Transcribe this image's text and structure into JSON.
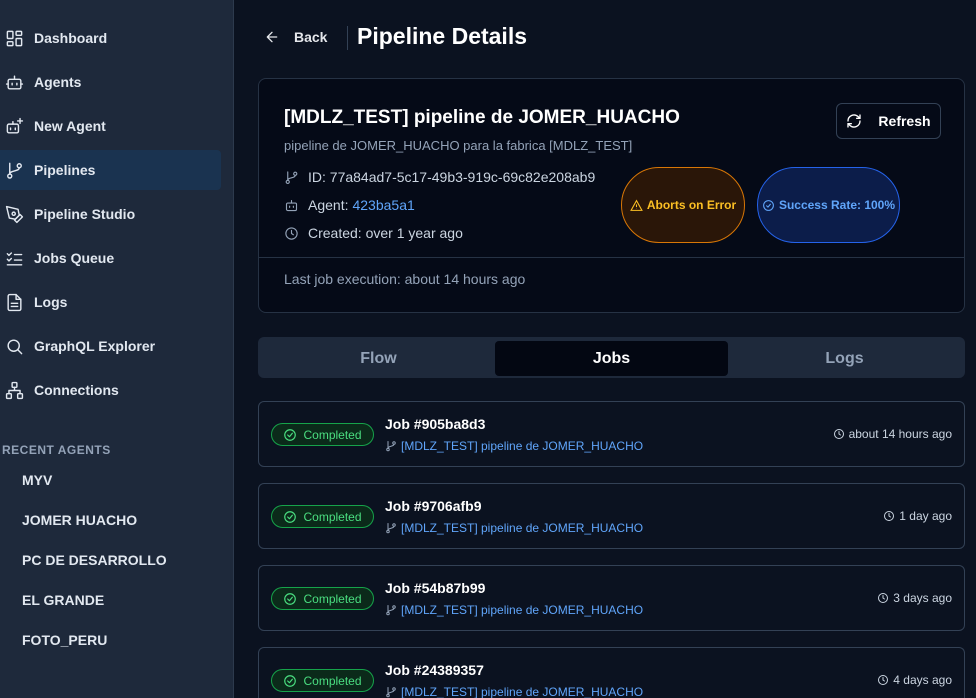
{
  "sidebar": {
    "items": [
      {
        "label": "Dashboard",
        "icon": "dashboard-icon"
      },
      {
        "label": "Agents",
        "icon": "bot-icon"
      },
      {
        "label": "New Agent",
        "icon": "bot-plus-icon"
      },
      {
        "label": "Pipelines",
        "icon": "git-branch-icon",
        "active": true
      },
      {
        "label": "Pipeline Studio",
        "icon": "pen-tool-icon"
      },
      {
        "label": "Jobs Queue",
        "icon": "list-checks-icon"
      },
      {
        "label": "Logs",
        "icon": "file-text-icon"
      },
      {
        "label": "GraphQL Explorer",
        "icon": "search-icon"
      },
      {
        "label": "Connections",
        "icon": "network-icon"
      }
    ],
    "recent_title": "RECENT AGENTS",
    "recent_agents": [
      "MYV",
      "JOMER HUACHO",
      "PC DE DESARROLLO",
      "EL GRANDE",
      "FOTO_PERU"
    ]
  },
  "header": {
    "back_label": "Back",
    "title": "Pipeline Details"
  },
  "pipeline": {
    "name": "[MDLZ_TEST] pipeline de JOMER_HUACHO",
    "description": "pipeline de JOMER_HUACHO para la fabrica [MDLZ_TEST]",
    "id_label": "ID: 77a84ad7-5c17-49b3-919c-69c82e208ab9",
    "agent_prefix": "Agent:",
    "agent_id": "423ba5a1",
    "created_label": "Created: over 1 year ago",
    "abort_badge": "Aborts on Error",
    "success_badge": "Success Rate: 100%",
    "refresh_label": "Refresh",
    "last_execution": "Last job execution: about 14 hours ago"
  },
  "tabs": [
    {
      "label": "Flow",
      "active": false
    },
    {
      "label": "Jobs",
      "active": true
    },
    {
      "label": "Logs",
      "active": false
    }
  ],
  "jobs": [
    {
      "status": "Completed",
      "title": "Job #905ba8d3",
      "pipeline": "[MDLZ_TEST] pipeline de JOMER_HUACHO",
      "time": "about 14 hours ago"
    },
    {
      "status": "Completed",
      "title": "Job #9706afb9",
      "pipeline": "[MDLZ_TEST] pipeline de JOMER_HUACHO",
      "time": "1 day ago"
    },
    {
      "status": "Completed",
      "title": "Job #54b87b99",
      "pipeline": "[MDLZ_TEST] pipeline de JOMER_HUACHO",
      "time": "3 days ago"
    },
    {
      "status": "Completed",
      "title": "Job #24389357",
      "pipeline": "[MDLZ_TEST] pipeline de JOMER_HUACHO",
      "time": "4 days ago"
    }
  ],
  "colors": {
    "accent_blue": "#60a5fa",
    "success_green": "#4ade80",
    "warning_amber": "#fbbf24"
  }
}
